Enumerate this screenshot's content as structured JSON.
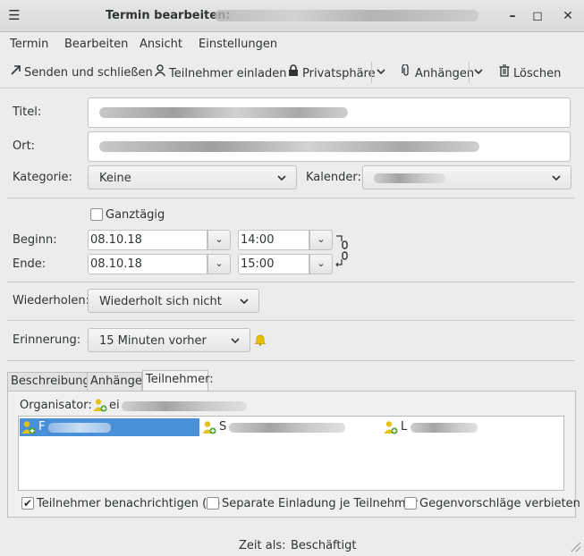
{
  "window": {
    "title": "Termin bearbeiten:",
    "minimize_icon": "minimize-icon",
    "maximize_icon": "maximize-icon",
    "close_icon": "close-icon"
  },
  "menu": {
    "items": [
      "Termin",
      "Bearbeiten",
      "Ansicht",
      "Einstellungen"
    ]
  },
  "toolbar": {
    "send_close": "Senden und schließen",
    "invite": "Teilnehmer einladen",
    "privacy": "Privatsphäre",
    "attachments": "Anhängen",
    "delete": "Löschen"
  },
  "form": {
    "title_label": "Titel:",
    "location_label": "Ort:",
    "category_label": "Kategorie:",
    "category_value": "Keine",
    "calendar_label": "Kalender:",
    "allday_label": "Ganztägig",
    "allday_checked": false,
    "start_label": "Beginn:",
    "start_date": "08.10.18",
    "start_time": "14:00",
    "end_label": "Ende:",
    "end_date": "08.10.18",
    "end_time": "15:00",
    "repeat_label": "Wiederholen:",
    "repeat_value": "Wiederholt sich nicht",
    "reminder_label": "Erinnerung:",
    "reminder_value": "15 Minuten vorher"
  },
  "tabs": [
    {
      "label": "Beschreibung:"
    },
    {
      "label": "Anhänge:"
    },
    {
      "label": "Teilnehmer:"
    }
  ],
  "attendees": {
    "organizer_label": "Organisator:",
    "organizer_prefix": "ei",
    "list": [
      {
        "initial": "F",
        "selected": true
      },
      {
        "initial": "S",
        "selected": false
      },
      {
        "initial": "L",
        "selected": false
      }
    ],
    "notify_label": "Teilnehmer benachrichtigen (Q)",
    "notify_checked": true,
    "separate_label": "Separate Einladung je Teilnehmer",
    "separate_checked": false,
    "counter_label": "Gegenvorschläge verbieten",
    "counter_checked": false
  },
  "status": {
    "show_as_label": "Zeit als:",
    "show_as_value": "Beschäftigt"
  },
  "colors": {
    "selection": "#4a90d9",
    "bell": "#e8c200"
  }
}
